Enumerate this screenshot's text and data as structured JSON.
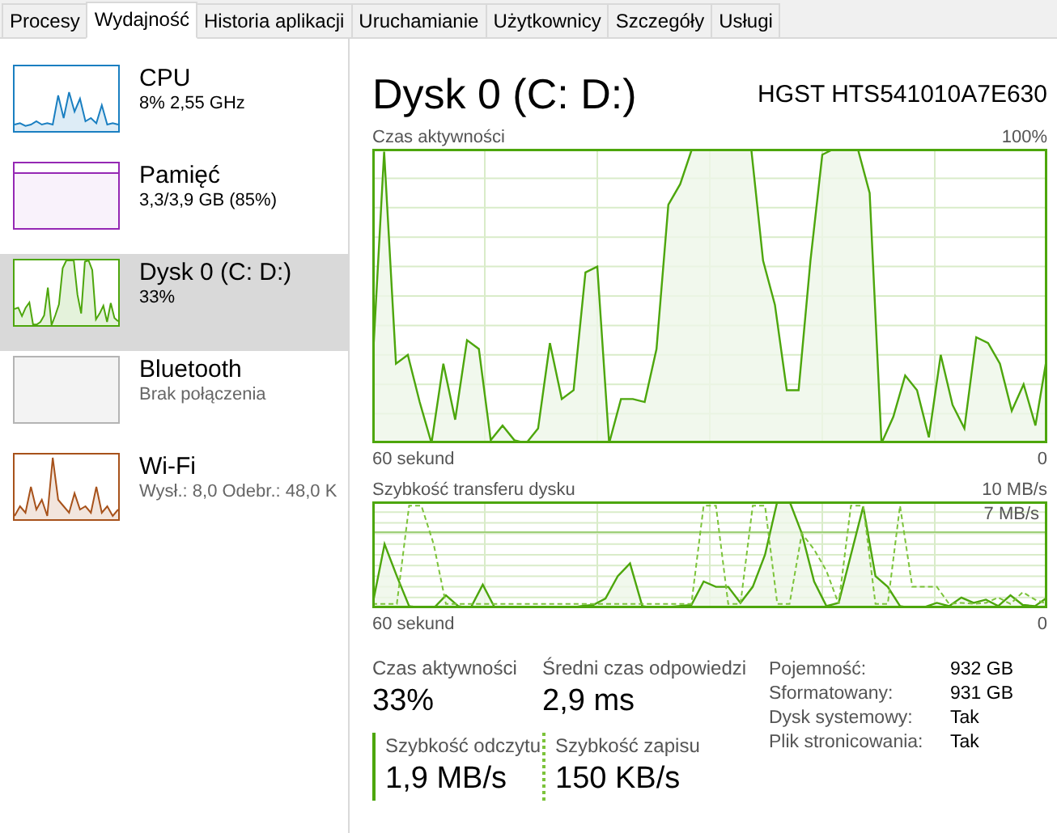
{
  "tabs": [
    {
      "label": "Procesy",
      "selected": false
    },
    {
      "label": "Wydajność",
      "selected": true
    },
    {
      "label": "Historia aplikacji",
      "selected": false
    },
    {
      "label": "Uruchamianie",
      "selected": false
    },
    {
      "label": "Użytkownicy",
      "selected": false
    },
    {
      "label": "Szczegóły",
      "selected": false
    },
    {
      "label": "Usługi",
      "selected": false
    }
  ],
  "sidebar": {
    "items": [
      {
        "name": "CPU",
        "detail": "8% 2,55 GHz",
        "color": "#1a7fc1",
        "kind": "graph",
        "selected": false
      },
      {
        "name": "Pamięć",
        "detail": "3,3/3,9 GB (85%)",
        "color": "#9528b4",
        "kind": "flat",
        "selected": false
      },
      {
        "name": "Dysk 0 (C: D:)",
        "detail": "33%",
        "color": "#4da60c",
        "kind": "graph",
        "selected": true
      },
      {
        "name": "Bluetooth",
        "detail": "Brak połączenia",
        "color": "#b4b4b4",
        "kind": "empty",
        "selected": false
      },
      {
        "name": "Wi-Fi",
        "detail": "Wysł.: 8,0 Odebr.: 48,0 K",
        "color": "#a7521b",
        "kind": "graph",
        "selected": false
      }
    ]
  },
  "disk": {
    "title": "Dysk 0 (C: D:)",
    "model": "HGST HTS541010A7E630",
    "activity_chart": {
      "label": "Czas aktywności",
      "max": "100%",
      "time": "60 sekund",
      "min": "0"
    },
    "transfer_chart": {
      "label": "Szybkość transferu dysku",
      "max": "10 MB/s",
      "marker": "7 MB/s",
      "time": "60 sekund",
      "min": "0"
    },
    "stats": [
      {
        "label": "Czas aktywności",
        "value": "33%"
      },
      {
        "label": "Średni czas odpowiedzi",
        "value": "2,9 ms"
      }
    ],
    "rates": [
      {
        "label": "Szybkość odczytu",
        "value": "1,9 MB/s",
        "kind": "read"
      },
      {
        "label": "Szybkość zapisu",
        "value": "150 KB/s",
        "kind": "write"
      }
    ],
    "properties": [
      {
        "label": "Pojemność:",
        "value": "932 GB"
      },
      {
        "label": "Sformatowany:",
        "value": "931 GB"
      },
      {
        "label": "Dysk systemowy:",
        "value": "Tak"
      },
      {
        "label": "Plik stronicowania:",
        "value": "Tak"
      }
    ]
  }
}
